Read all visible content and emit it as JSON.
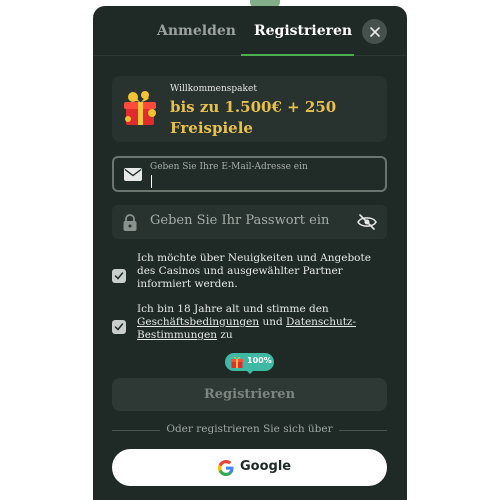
{
  "tabs": {
    "login": "Anmelden",
    "register": "Registrieren",
    "active": "register"
  },
  "promo": {
    "label": "Willkommenspaket",
    "line1": "bis zu 1.500€ + 250",
    "line2": "Freispiele",
    "icon": "gift-icon"
  },
  "email": {
    "label": "Geben Sie Ihre E-Mail-Adresse ein",
    "value": "",
    "icon": "mail-icon"
  },
  "password": {
    "placeholder": "Geben Sie Ihr Passwort ein",
    "icon": "lock-icon",
    "toggle_icon": "eye-slash-icon"
  },
  "consents": {
    "newsletter": {
      "checked": true,
      "text": "Ich möchte über Neuigkeiten und Angebote des Casinos und ausgewählter Partner informiert werden."
    },
    "terms": {
      "checked": true,
      "prefix": "Ich bin 18 Jahre alt und stimme den",
      "terms_link": "Geschäftsbedingungen",
      "and": "und",
      "privacy_link": "Datenschutz-Bestimmungen",
      "suffix": "zu"
    }
  },
  "progress": {
    "value": 1.0,
    "label": "100%"
  },
  "register_button": "Registrieren",
  "divider_text": "Oder registrieren Sie sich über",
  "google_button": "Google",
  "colors": {
    "accent_green": "#4caf50",
    "promo_gold": "#e8c14d",
    "badge_teal": "#3fb8a4",
    "modal_bg": "#1f2a27"
  }
}
